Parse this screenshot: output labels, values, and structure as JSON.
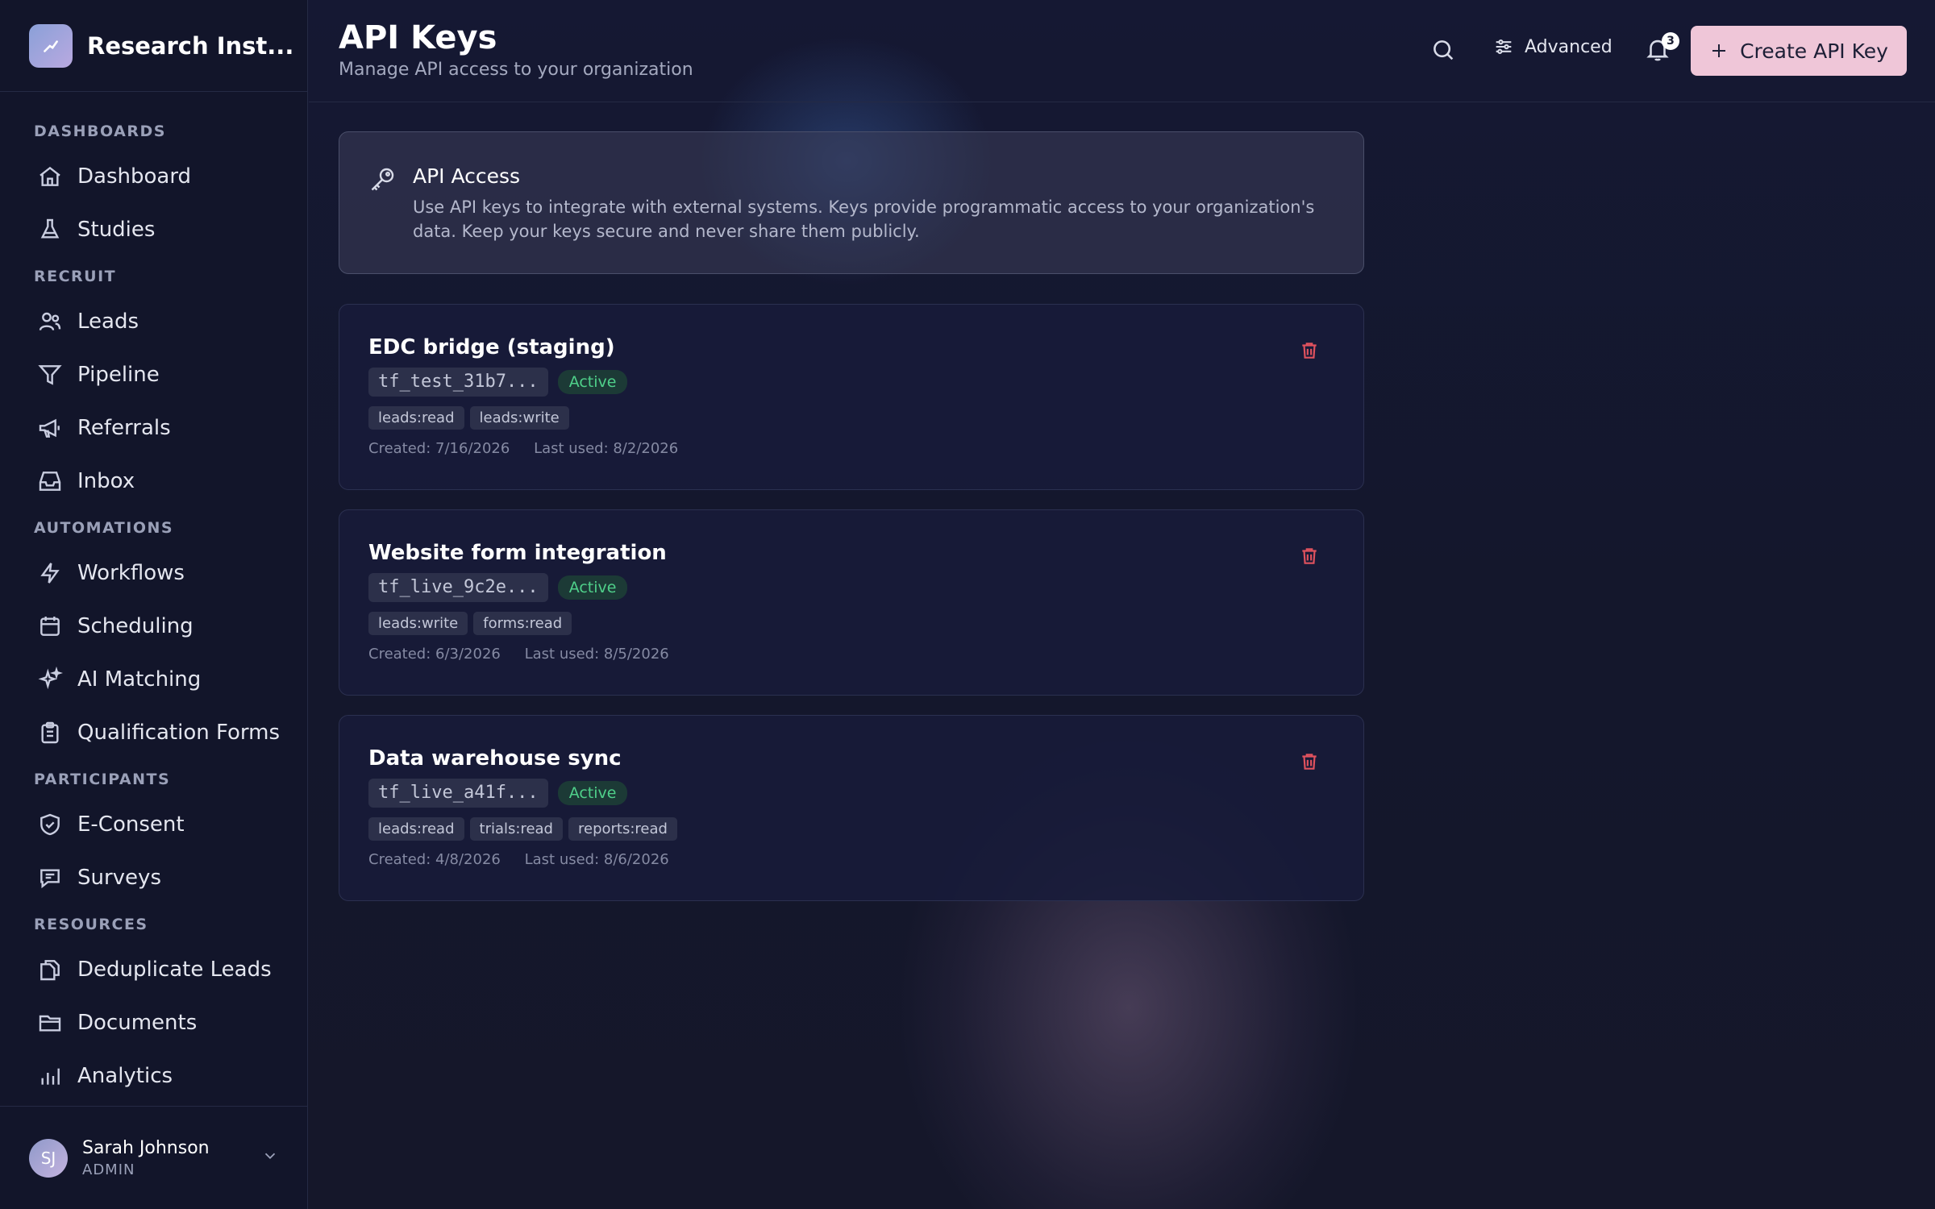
{
  "sidebar": {
    "brand": "Research Inst...",
    "brand_icon": "trend-icon",
    "sections": [
      {
        "label": "DASHBOARDS",
        "items": [
          {
            "label": "Dashboard",
            "icon": "home-icon"
          },
          {
            "label": "Studies",
            "icon": "flask-icon"
          }
        ]
      },
      {
        "label": "RECRUIT",
        "items": [
          {
            "label": "Leads",
            "icon": "users-icon"
          },
          {
            "label": "Pipeline",
            "icon": "filter-icon"
          },
          {
            "label": "Referrals",
            "icon": "megaphone-icon"
          },
          {
            "label": "Inbox",
            "icon": "inbox-icon"
          }
        ]
      },
      {
        "label": "AUTOMATIONS",
        "items": [
          {
            "label": "Workflows",
            "icon": "bolt-icon"
          },
          {
            "label": "Scheduling",
            "icon": "calendar-icon"
          },
          {
            "label": "AI Matching",
            "icon": "sparkles-icon"
          },
          {
            "label": "Qualification Forms",
            "icon": "clipboard-icon"
          }
        ]
      },
      {
        "label": "PARTICIPANTS",
        "items": [
          {
            "label": "E-Consent",
            "icon": "shield-check-icon"
          },
          {
            "label": "Surveys",
            "icon": "chat-icon"
          }
        ]
      },
      {
        "label": "RESOURCES",
        "items": [
          {
            "label": "Deduplicate Leads",
            "icon": "copy-icon"
          },
          {
            "label": "Documents",
            "icon": "folder-icon"
          },
          {
            "label": "Analytics",
            "icon": "chart-icon"
          }
        ]
      }
    ],
    "user": {
      "initials": "SJ",
      "name": "Sarah Johnson",
      "role": "ADMIN"
    }
  },
  "header": {
    "title": "API Keys",
    "subtitle": "Manage API access to your organization",
    "advanced_label": "Advanced",
    "notifications_count": "3",
    "create_label": "Create API Key"
  },
  "info": {
    "title": "API Access",
    "text": "Use API keys to integrate with external systems. Keys provide programmatic access to your organization's data. Keep your keys secure and never share them publicly."
  },
  "keys": [
    {
      "name": "EDC bridge (staging)",
      "key": "tf_test_31b7...",
      "status": "Active",
      "scopes": [
        "leads:read",
        "leads:write"
      ],
      "created": "Created: 7/16/2026",
      "last_used": "Last used: 8/2/2026"
    },
    {
      "name": "Website form integration",
      "key": "tf_live_9c2e...",
      "status": "Active",
      "scopes": [
        "leads:write",
        "forms:read"
      ],
      "created": "Created: 6/3/2026",
      "last_used": "Last used: 8/5/2026"
    },
    {
      "name": "Data warehouse sync",
      "key": "tf_live_a41f...",
      "status": "Active",
      "scopes": [
        "leads:read",
        "trials:read",
        "reports:read"
      ],
      "created": "Created: 4/8/2026",
      "last_used": "Last used: 8/6/2026"
    }
  ],
  "colors": {
    "accent": "#efc6d8",
    "active": "#4fd08a",
    "danger": "#e0525e"
  }
}
